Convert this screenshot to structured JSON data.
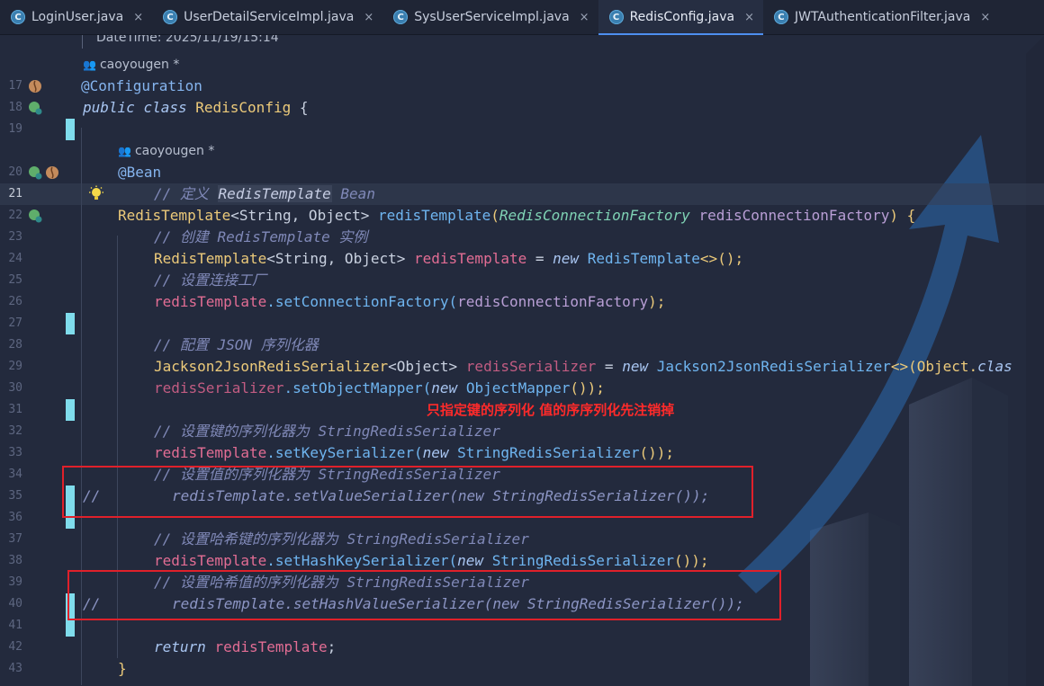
{
  "tabs": [
    {
      "label": "LoginUser.java",
      "active": false
    },
    {
      "label": "UserDetailServiceImpl.java",
      "active": false
    },
    {
      "label": "SysUserServiceImpl.java",
      "active": false
    },
    {
      "label": "RedisConfig.java",
      "active": true
    },
    {
      "label": "JWTAuthenticationFilter.java",
      "active": false
    }
  ],
  "tab_icon_letter": "C",
  "tab_close_glyph": "×",
  "header_comment": "DateTime: 2025/11/19/15:14",
  "authors": {
    "class_author": "caoyougen *",
    "bean_author": "caoyougen *"
  },
  "line_numbers": [
    "17",
    "18",
    "19",
    "20",
    "21",
    "22",
    "23",
    "24",
    "25",
    "26",
    "27",
    "28",
    "29",
    "30",
    "31",
    "32",
    "33",
    "34",
    "35",
    "36",
    "37",
    "38",
    "39",
    "40",
    "41",
    "42",
    "43"
  ],
  "code": {
    "l17": "@Configuration",
    "l18_kw1": "public",
    "l18_kw2": "class",
    "l18_name": "RedisConfig",
    "l18_brace": "{",
    "l20": "@Bean",
    "l21_prefix": "// 定义 ",
    "l21_hl": "RedisTemplate",
    "l21_suffix": " Bean",
    "l22_type": "RedisTemplate",
    "l22_generic": "<String, Object>",
    "l22_fn": "redisTemplate",
    "l22_open": "(",
    "l22_ptype": "RedisConnectionFactory",
    "l22_param": "redisConnectionFactory",
    "l22_close": ") {",
    "l23": "// 创建 RedisTemplate 实例",
    "l24_type": "RedisTemplate",
    "l24_generic": "<String, Object>",
    "l24_var": "redisTemplate",
    "l24_eq": " = ",
    "l24_new": "new",
    "l24_type2": "RedisTemplate",
    "l24_end": "<>();",
    "l25": "// 设置连接工厂",
    "l26_obj": "redisTemplate",
    "l26_fn": ".setConnectionFactory(",
    "l26_arg": "redisConnectionFactory",
    "l26_end": ");",
    "l28": "// 配置 JSON 序列化器",
    "l29_type": "Jackson2JsonRedisSerializer",
    "l29_generic": "<Object>",
    "l29_var": "redisSerializer",
    "l29_eq": " = ",
    "l29_new": "new",
    "l29_type2": "Jackson2JsonRedisSerializer",
    "l29_end": "<>(Object.",
    "l29_tail": "clas",
    "l30_obj": "redisSerializer",
    "l30_fn": ".setObjectMapper(",
    "l30_new": "new",
    "l30_type": "ObjectMapper",
    "l30_end": "());",
    "l32": "// 设置键的序列化器为 StringRedisSerializer",
    "l33_obj": "redisTemplate",
    "l33_fn": ".setKeySerializer(",
    "l33_new": "new",
    "l33_type": "StringRedisSerializer",
    "l33_end": "());",
    "l34": "// 设置值的序列化器为 StringRedisSerializer",
    "l35_marker": "//",
    "l35_code": "redisTemplate.setValueSerializer(new StringRedisSerializer());",
    "l37": "// 设置哈希键的序列化器为 StringRedisSerializer",
    "l38_obj": "redisTemplate",
    "l38_fn": ".setHashKeySerializer(",
    "l38_new": "new",
    "l38_type": "StringRedisSerializer",
    "l38_end": "());",
    "l39": "// 设置哈希值的序列化器为 StringRedisSerializer",
    "l40_marker": "//",
    "l40_code": "redisTemplate.setHashValueSerializer(new StringRedisSerializer());",
    "l42_kw": "return",
    "l42_var": "redisTemplate",
    "l42_end": ";",
    "l43": "}"
  },
  "annotation_note": "只指定键的序列化 值的序序列化先注销掉",
  "colors": {
    "background": "#232a3d",
    "accent": "#4d8ef0",
    "annotation_red": "#e0202a",
    "change_marker": "#7fdcec"
  }
}
